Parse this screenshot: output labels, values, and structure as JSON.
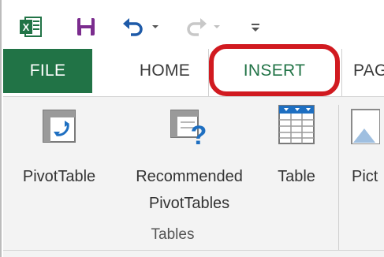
{
  "quick_access": {
    "icons": [
      "excel-logo-icon",
      "save-icon",
      "undo-icon",
      "dropdown-arrow-icon",
      "redo-icon",
      "dropdown-arrow-icon",
      "customize-qat-icon"
    ]
  },
  "tabs": {
    "file": "FILE",
    "home": "HOME",
    "insert": "INSERT",
    "page_partial": "PAG"
  },
  "ribbon": {
    "pivot_table": "PivotTable",
    "recommended_line1": "Recommended",
    "recommended_line2": "PivotTables",
    "table": "Table",
    "pictures_partial": "Pict",
    "group_tables": "Tables"
  },
  "colors": {
    "file_tab_bg": "#217346",
    "insert_tab_text": "#217346",
    "highlight_ring": "#d11a20",
    "ribbon_bg": "#f3f3f3"
  }
}
